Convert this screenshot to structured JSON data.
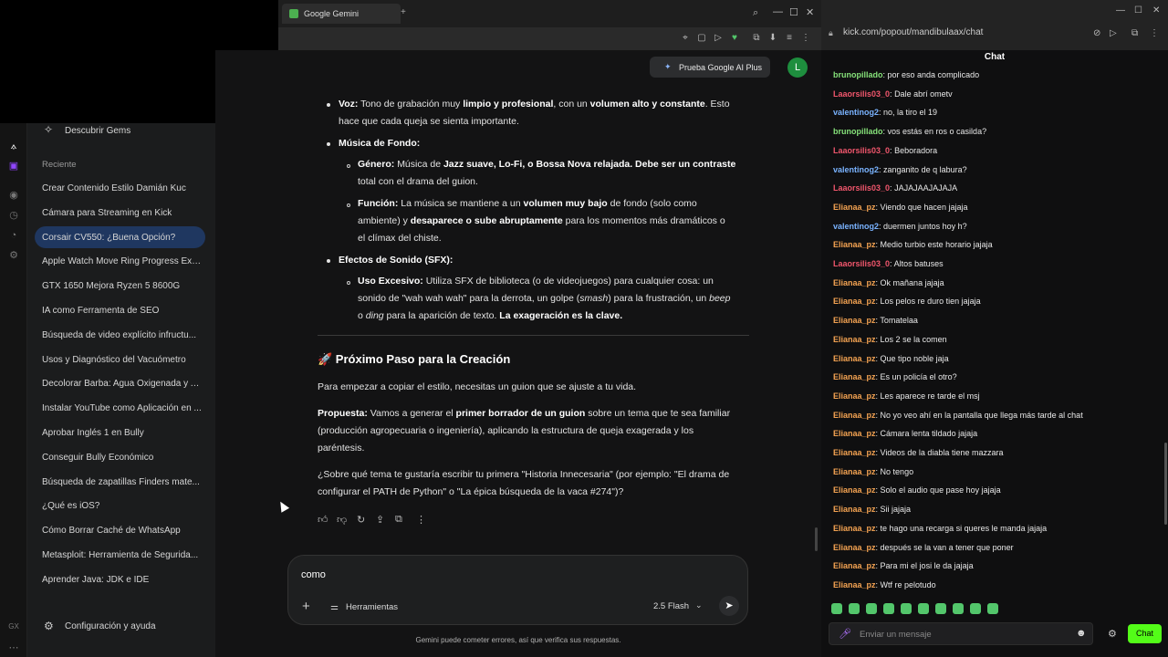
{
  "browser": {
    "tab_title": "Google Gemini",
    "new_tab_glyph": "+",
    "window_controls": [
      "🔍",
      "—",
      "☐",
      "✕"
    ],
    "toolbar_icons": [
      "📌",
      "▢",
      "▷",
      "❤",
      "⇪",
      "⬇",
      "≡",
      "⋯"
    ]
  },
  "kick": {
    "url": "kick.com/popout/mandibulaax/chat",
    "chat_title": "Chat",
    "send_placeholder": "Enviar un mensaje",
    "chat_button": "Chat",
    "messages": [
      {
        "user": "brunopillado",
        "color": "#86e27a",
        "text": "por eso anda complicado"
      },
      {
        "user": "Laaorsilis03_0",
        "color": "#f0566c",
        "text": "Dale abrí ometv"
      },
      {
        "user": "valentinog2",
        "color": "#7ab3ff",
        "text": "no, la tiro el 19"
      },
      {
        "user": "brunopillado",
        "color": "#86e27a",
        "text": "vos estás en ros o casilda?"
      },
      {
        "user": "Laaorsilis03_0",
        "color": "#f0566c",
        "text": "Beboradora"
      },
      {
        "user": "valentinog2",
        "color": "#7ab3ff",
        "text": "zanganito de q labura?"
      },
      {
        "user": "Laaorsilis03_0",
        "color": "#f0566c",
        "text": "JAJAJAAJAJAJA"
      },
      {
        "user": "Elianaa_pz",
        "color": "#f4a352",
        "text": "Viendo que hacen jajaja"
      },
      {
        "user": "valentinog2",
        "color": "#7ab3ff",
        "text": "duermen juntos hoy h?"
      },
      {
        "user": "Elianaa_pz",
        "color": "#f4a352",
        "text": "Medio turbio este horario jajaja"
      },
      {
        "user": "Laaorsilis03_0",
        "color": "#f0566c",
        "text": "Altos batuses"
      },
      {
        "user": "Elianaa_pz",
        "color": "#f4a352",
        "text": "Ok mañana jajaja"
      },
      {
        "user": "Elianaa_pz",
        "color": "#f4a352",
        "text": "Los pelos re duro tien jajaja"
      },
      {
        "user": "Elianaa_pz",
        "color": "#f4a352",
        "text": "Tomatelaa"
      },
      {
        "user": "Elianaa_pz",
        "color": "#f4a352",
        "text": "Los 2 se la comen"
      },
      {
        "user": "Elianaa_pz",
        "color": "#f4a352",
        "text": "Que tipo noble jaja"
      },
      {
        "user": "Elianaa_pz",
        "color": "#f4a352",
        "text": "Es un policía el otro?"
      },
      {
        "user": "Elianaa_pz",
        "color": "#f4a352",
        "text": "Les aparece re tarde el msj"
      },
      {
        "user": "Elianaa_pz",
        "color": "#f4a352",
        "text": "No yo veo ahí en la pantalla que llega más tarde al chat"
      },
      {
        "user": "Elianaa_pz",
        "color": "#f4a352",
        "text": "Cámara lenta tildado jajaja"
      },
      {
        "user": "Elianaa_pz",
        "color": "#f4a352",
        "text": "Videos de la diabla tiene mazzara"
      },
      {
        "user": "Elianaa_pz",
        "color": "#f4a352",
        "text": "No tengo"
      },
      {
        "user": "Elianaa_pz",
        "color": "#f4a352",
        "text": "Solo el audio que pase hoy jajaja"
      },
      {
        "user": "Elianaa_pz",
        "color": "#f4a352",
        "text": "Sii jajaja"
      },
      {
        "user": "Elianaa_pz",
        "color": "#f4a352",
        "text": "te hago una recarga si queres le manda jajaja"
      },
      {
        "user": "Elianaa_pz",
        "color": "#f4a352",
        "text": "después se la van a tener que poner"
      },
      {
        "user": "Elianaa_pz",
        "color": "#f4a352",
        "text": "Para mi el josi le da jajaja"
      },
      {
        "user": "Elianaa_pz",
        "color": "#f4a352",
        "text": "Wtf re pelotudo"
      }
    ]
  },
  "gemini": {
    "discover_gems": "Descubrir Gems",
    "recent_label": "Reciente",
    "recent": [
      "Crear Contenido Estilo Damián Kuc",
      "Cámara para Streaming en Kick",
      "Corsair CV550: ¿Buena Opción?",
      "Apple Watch Move Ring Progress Exp...",
      "GTX 1650 Mejora Ryzen 5 8600G",
      "IA como Ferramenta de SEO",
      "Búsqueda de video explícito infructu...",
      "Usos y Diagnóstico del Vacuómetro",
      "Decolorar Barba: Agua Oxigenada y A...",
      "Instalar YouTube como Aplicación en ...",
      "Aprobar Inglés 1 en Bully",
      "Conseguir Bully Económico",
      "Búsqueda de zapatillas Finders mate...",
      "¿Qué es iOS?",
      "Cómo Borrar Caché de WhatsApp",
      "Metasploit: Herramienta de Segurida...",
      "Aprender Java: JDK e IDE"
    ],
    "settings": "Configuración y ayuda",
    "gx_label": "GX",
    "upgrade": "Prueba Google AI Plus",
    "avatar": "L",
    "voz_label": "Voz:",
    "voz_text_1": "Tono de grabación muy ",
    "voz_b1": "limpio y profesional",
    "voz_text_2": ", con un ",
    "voz_b2": "volumen alto y constante",
    "voz_text_3": ". Esto",
    "voz_line2": "hace que cada queja se sienta importante.",
    "musica_label": "Música de Fondo:",
    "genero_label": "Género:",
    "genero_t1": "Música de ",
    "genero_b1": "Jazz suave, Lo-Fi, o Bossa Nova relajada.",
    "genero_b2": " Debe ser un contraste",
    "genero_line2": "total con el drama del guion.",
    "funcion_label": "Función:",
    "funcion_t1": "La música se mantiene a un ",
    "funcion_b1": "volumen muy bajo",
    "funcion_t2": " de fondo (solo como",
    "funcion_l2a": "ambiente) y ",
    "funcion_l2b": "desaparece o sube abruptamente",
    "funcion_l2c": " para los momentos más dramáticos o",
    "funcion_line3": "el clímax del chiste.",
    "efectos_label": "Efectos de Sonido (SFX):",
    "uso_label": "Uso Excesivo:",
    "uso_t1": "Utiliza SFX de biblioteca (o de videojuegos) para cualquier cosa: un",
    "uso_l2a": "sonido de \"wah wah wah\" para la derrota, un golpe (",
    "uso_l2b": "smash",
    "uso_l2c": ") para la frustración, un ",
    "uso_l2d": "beep",
    "uso_l3a": "o ",
    "uso_l3b": "ding",
    "uso_l3c": " para la aparición de texto. ",
    "uso_l3d": "La exageración es la clave.",
    "next_heading": "🚀 Próximo Paso para la Creación",
    "next_p1": "Para empezar a copiar el estilo, necesitas un guion que se ajuste a tu vida.",
    "prop_label": "Propuesta:",
    "prop_t1": " Vamos a generar el ",
    "prop_b1": "primer borrador de un guion",
    "prop_t2": " sobre un tema que te sea familiar",
    "prop_line2": "(producción agropecuaria o ingeniería), aplicando la estructura de queja exagerada y los",
    "prop_line3": "paréntesis.",
    "q_line1": "¿Sobre qué tema te gustaría escribir tu primera \"Historia Innecesaria\" (por ejemplo: \"El drama de",
    "q_line2": "configurar el PATH de Python\" o \"La épica búsqueda de la vaca #274\")?",
    "input_value": "como",
    "tools_label": "Herramientas",
    "model_label": "2.5 Flash",
    "disclaimer": "Gemini puede cometer errores, así que verifica sus respuestas."
  }
}
